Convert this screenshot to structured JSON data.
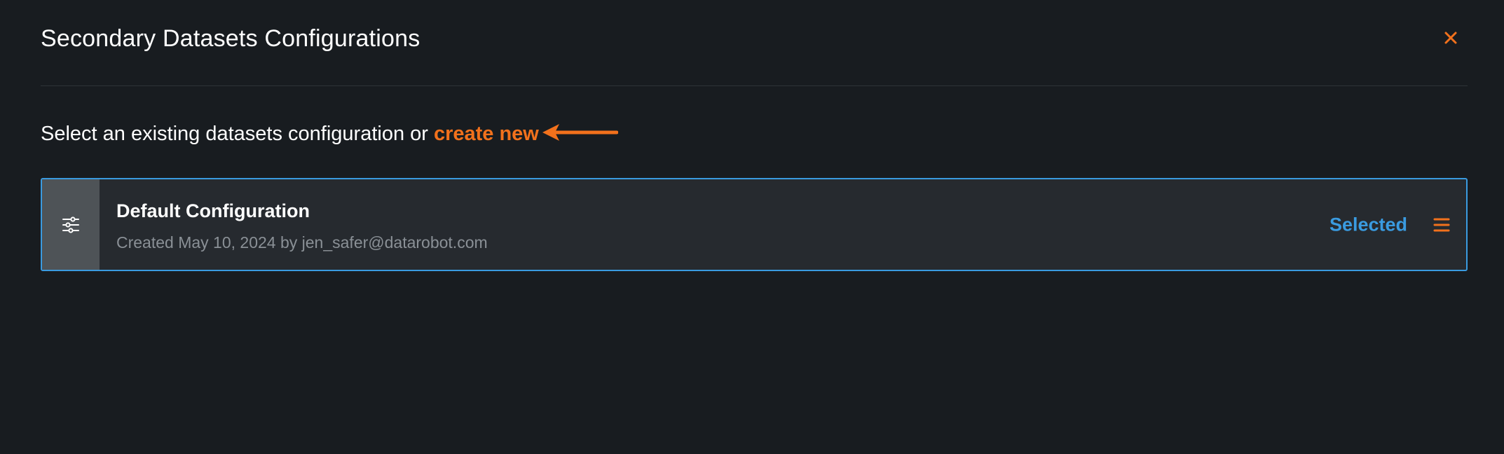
{
  "dialog": {
    "title": "Secondary Datasets Configurations",
    "close_icon": "close-icon"
  },
  "instruction": {
    "text": "Select an existing datasets configuration or",
    "link_label": "create new"
  },
  "configurations": [
    {
      "icon": "sliders-icon",
      "name": "Default Configuration",
      "meta": "Created May 10, 2024 by jen_safer@datarobot.com",
      "status": "Selected",
      "menu_icon": "menu-icon"
    }
  ],
  "colors": {
    "background": "#181c20",
    "card_background": "#262a2f",
    "accent_orange": "#f2711c",
    "selected_blue": "#3a9be0",
    "muted_text": "#8a9096"
  }
}
